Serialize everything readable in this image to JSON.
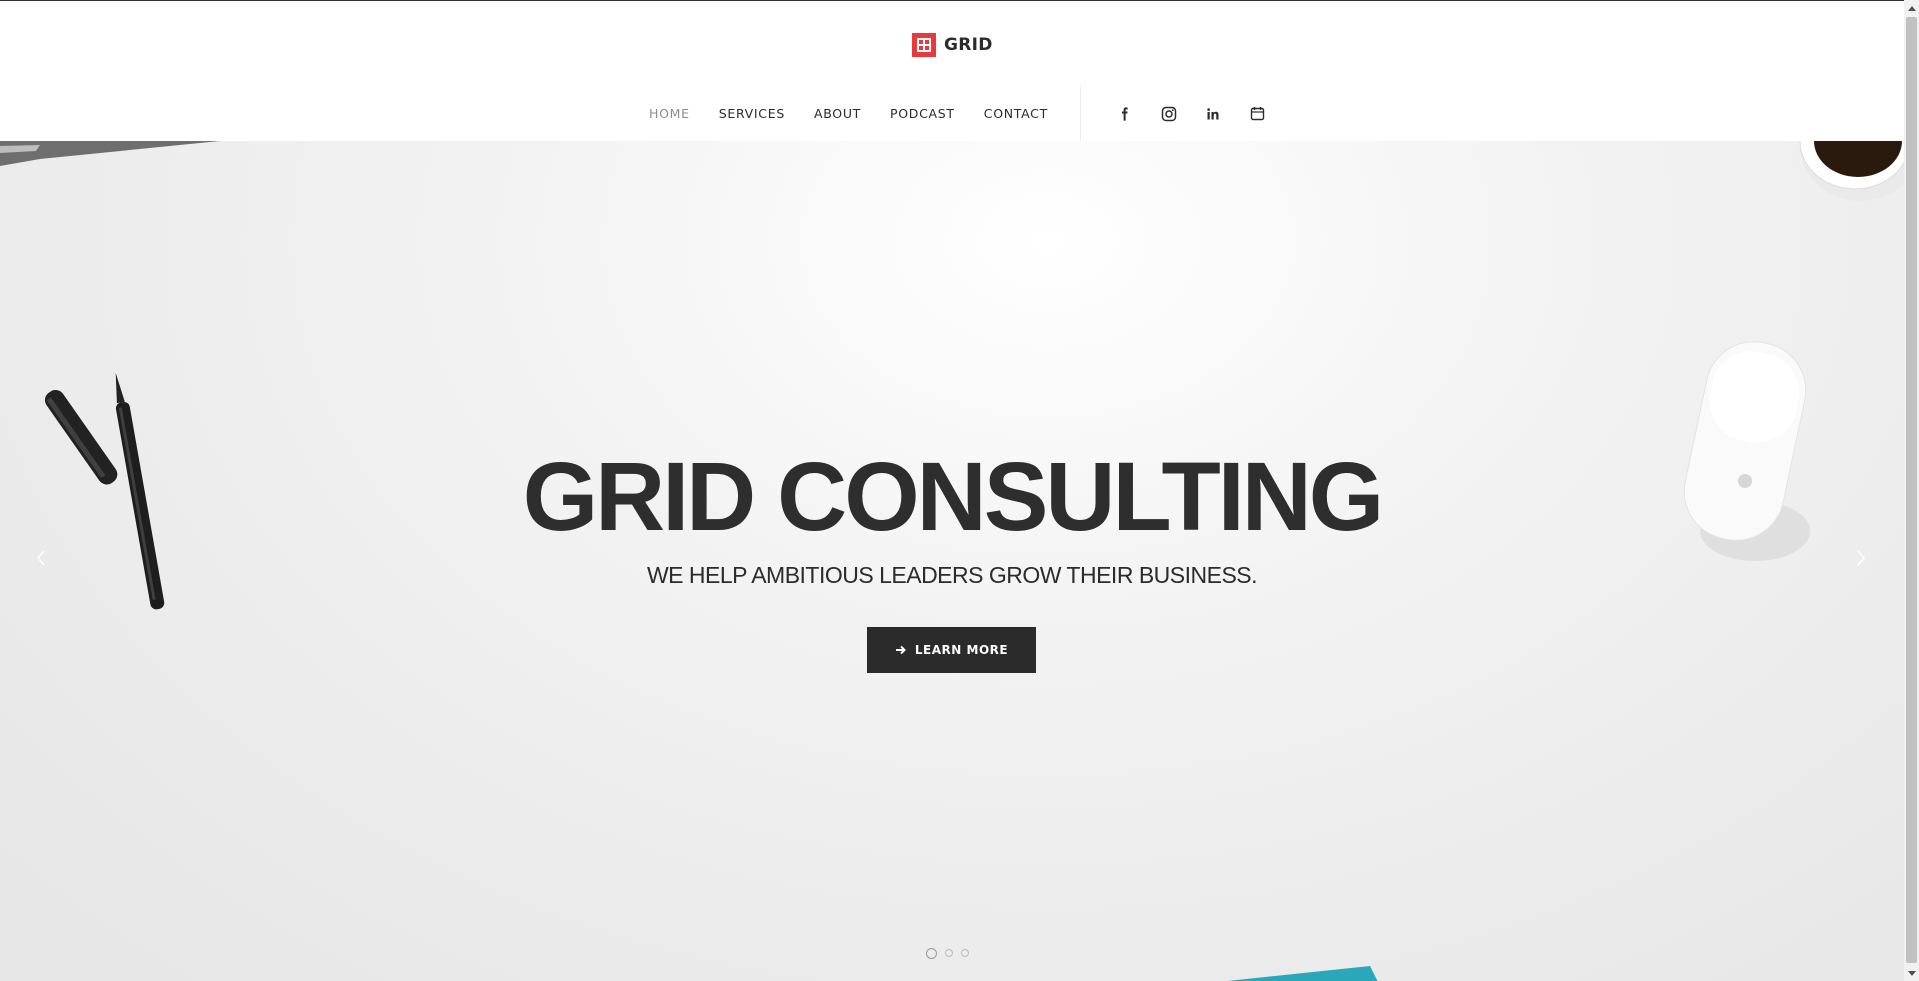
{
  "brand": {
    "name": "GRID",
    "accent": "#e63a3f"
  },
  "nav": {
    "items": [
      {
        "label": "HOME",
        "active": true
      },
      {
        "label": "SERVICES"
      },
      {
        "label": "ABOUT"
      },
      {
        "label": "PODCAST"
      },
      {
        "label": "CONTACT"
      }
    ],
    "social": [
      "facebook-icon",
      "instagram-icon",
      "linkedin-icon",
      "calendar-icon"
    ]
  },
  "hero": {
    "title": "GRID CONSULTING",
    "subtitle": "WE HELP AMBITIOUS LEADERS GROW THEIR BUSINESS.",
    "cta_label": "LEARN MORE",
    "slides": 3,
    "active_slide": 1
  },
  "colors": {
    "dark": "#2b2b2b",
    "nav_active": "#8d8d8d"
  }
}
